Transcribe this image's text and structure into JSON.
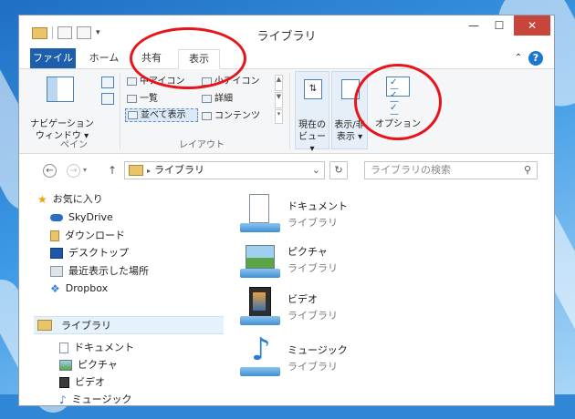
{
  "window": {
    "title": "ライブラリ",
    "controls": {
      "minimize": "—",
      "maximize": "☐",
      "close": "✕"
    }
  },
  "ribbon": {
    "tabs": [
      {
        "label": "ファイル"
      },
      {
        "label": "ホーム"
      },
      {
        "label": "共有"
      },
      {
        "label": "表示"
      }
    ],
    "collapse": "⌃",
    "help": "?",
    "pane_group": {
      "nav_pane_label": "ナビゲーション\nウィンドウ ▾",
      "group_label": "ペイン"
    },
    "layout_group": {
      "options": [
        {
          "label": "中アイコン"
        },
        {
          "label": "小アイコン"
        },
        {
          "label": "一覧"
        },
        {
          "label": "詳細"
        },
        {
          "label": "並べて表示"
        },
        {
          "label": "コンテンツ"
        }
      ],
      "group_label": "レイアウト"
    },
    "current_view": {
      "label": "現在の\nビュー ▾"
    },
    "show_hide": {
      "label": "表示/非\n表示 ▾"
    },
    "options": {
      "label": "オプション"
    }
  },
  "address": {
    "back": "←",
    "forward": "→",
    "up": "↑",
    "breadcrumb_sep": "▸",
    "path": "ライブラリ",
    "dropdown": "⌄",
    "refresh": "↻",
    "search_placeholder": "ライブラリの検索",
    "search_icon": "⚲"
  },
  "navigation": {
    "favorites_label": "お気に入り",
    "favorites": [
      {
        "label": "SkyDrive"
      },
      {
        "label": "ダウンロード"
      },
      {
        "label": "デスクトップ"
      },
      {
        "label": "最近表示した場所"
      },
      {
        "label": "Dropbox"
      }
    ],
    "libraries_label": "ライブラリ",
    "libraries": [
      {
        "label": "ドキュメント"
      },
      {
        "label": "ピクチャ"
      },
      {
        "label": "ビデオ"
      },
      {
        "label": "ミュージック"
      }
    ]
  },
  "content": {
    "items": [
      {
        "name": "ドキュメント",
        "sub": "ライブラリ"
      },
      {
        "name": "ピクチャ",
        "sub": "ライブラリ"
      },
      {
        "name": "ビデオ",
        "sub": "ライブラリ"
      },
      {
        "name": "ミュージック",
        "sub": "ライブラリ"
      }
    ]
  },
  "colors": {
    "file_tab": "#1e5fad",
    "highlight_ring": "#e8141a",
    "close_button": "#c8453b",
    "selection": "#dbe9f7"
  }
}
